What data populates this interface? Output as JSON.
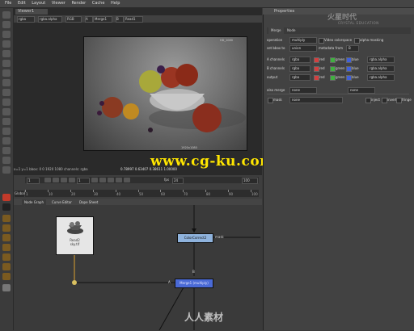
{
  "menu": [
    "File",
    "Edit",
    "Layout",
    "Viewer",
    "Render",
    "Cache",
    "Help"
  ],
  "viewer": {
    "tab_label": "Viewer1",
    "controls": [
      "rgba",
      "rgba.alpha",
      "RGB",
      "A",
      "Merge1",
      "B",
      "Read1"
    ],
    "image_caption": "HD_1080 1920x1080",
    "info_text": "x=1 y=1 bbox: 0 0 1920 1080 channels: rgba",
    "color_values": "0.78997  0.63407  0.38611  1.00000",
    "watermark": "www.cg-ku.com"
  },
  "timeline": {
    "start_frame": "1",
    "end_frame": "100",
    "current_frame": "1",
    "fps_label": "fps",
    "fps": "24",
    "ticks": [
      "1",
      "10",
      "20",
      "30",
      "40",
      "50",
      "60",
      "70",
      "80",
      "90",
      "100"
    ],
    "mode_label": "Global"
  },
  "nodegraph": {
    "tabs": [
      "Node Graph",
      "Curve Editor",
      "Dope Sheet"
    ],
    "nodes": {
      "read": {
        "label": "Read2",
        "sub": "sky.tif"
      },
      "colorcorrect": {
        "label": "ColorCorrect2"
      },
      "merge": {
        "label": "Merge1 (multiply)"
      }
    },
    "labels": {
      "mask": "mask",
      "b": "B",
      "a": "A"
    },
    "watermark": "人人素材"
  },
  "properties": {
    "title": "Properties",
    "tabs": [
      "Merge",
      "Node"
    ],
    "rows": [
      {
        "label": "operation",
        "value": "multiply",
        "check_label": "Video colorspace",
        "check2_label": "alpha masking"
      },
      {
        "label": "set bbox to",
        "value": "union",
        "extra_label": "metadata from",
        "extra_value": "B"
      },
      {
        "label": "A channels",
        "value": "rgba",
        "flags": [
          "red",
          "green",
          "blue"
        ],
        "alpha": "rgba.alpha"
      },
      {
        "label": "B channels",
        "value": "rgba",
        "flags": [
          "red",
          "green",
          "blue"
        ],
        "alpha": "rgba.alpha"
      },
      {
        "label": "output",
        "value": "rgba",
        "flags": [
          "red",
          "green",
          "blue"
        ],
        "alpha": "rgba.alpha"
      },
      {
        "label": "also merge",
        "value": "none",
        "extra_value": "none"
      },
      {
        "label": "mask",
        "value": "none",
        "check_label": "inject",
        "check2_label": "invert",
        "check3_label": "fringe"
      }
    ],
    "logo_text": "火星时代",
    "logo_sub": "CRYSTAL EDUCATION"
  }
}
